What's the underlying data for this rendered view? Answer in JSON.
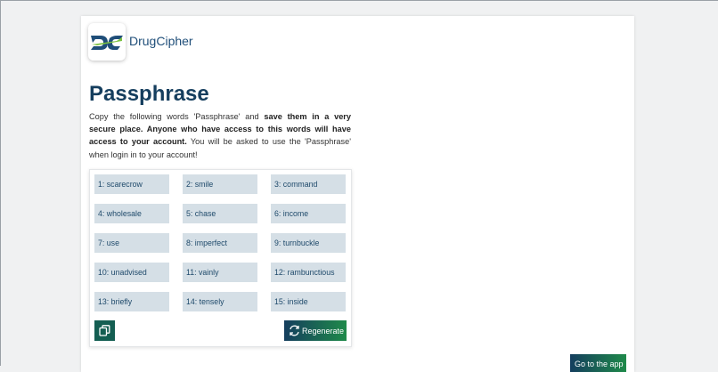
{
  "brand": {
    "name": "DrugCipher"
  },
  "page": {
    "title": "Passphrase",
    "desc_1": "Copy the following words 'Passphrase' and ",
    "desc_bold": "save them in a very secure place. Anyone who have access to this words will have access to your account.",
    "desc_2": " You will be asked to use the 'Passphrase' when login in to your account!"
  },
  "words": [
    "1: scarecrow",
    "2: smile",
    "3: command",
    "4: wholesale",
    "5: chase",
    "6: income",
    "7: use",
    "8: imperfect",
    "9: turnbuckle",
    "10: unadvised",
    "11: vainly",
    "12: rambunctious",
    "13: briefly",
    "14: tensely",
    "15: inside"
  ],
  "actions": {
    "regenerate_label": "Regenerate",
    "next_label": "Go to the app"
  },
  "colors": {
    "navy": "#153e5e",
    "green": "#1f8a4a",
    "word_bg": "#d5dfe6"
  }
}
